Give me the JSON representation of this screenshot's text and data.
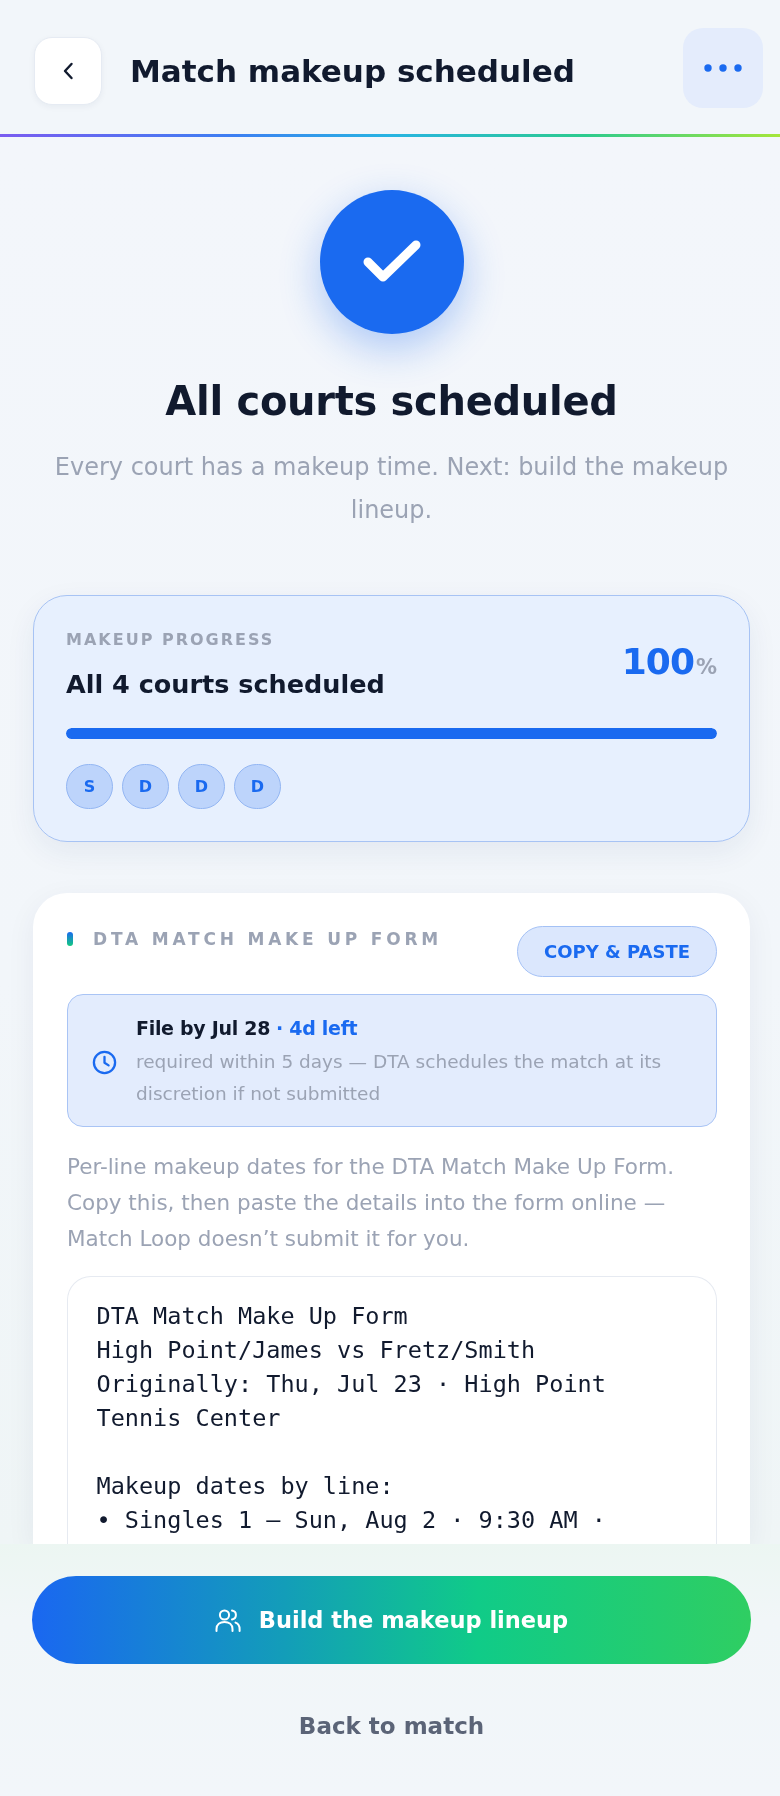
{
  "header": {
    "title": "Match makeup scheduled"
  },
  "hero": {
    "title": "All courts scheduled",
    "subtitle": "Every court has a makeup time. Next: build the makeup lineup."
  },
  "progress": {
    "label": "MAKEUP PROGRESS",
    "title": "All 4 courts scheduled",
    "percent": "100",
    "percent_sign": "%",
    "level": 1,
    "courts": [
      {
        "label": "S",
        "scheduled": true
      },
      {
        "label": "D",
        "scheduled": true
      },
      {
        "label": "D",
        "scheduled": true
      },
      {
        "label": "D",
        "scheduled": true
      }
    ]
  },
  "form": {
    "title": "DTA MATCH MAKE UP FORM",
    "copy_button": "COPY & PASTE",
    "deadline": {
      "title": "File by Jul 28",
      "remaining": "· 4d left",
      "note": "required within 5 days — DTA schedules the match at its discretion if not submitted"
    },
    "description": "Per-line makeup dates for the DTA Match Make Up Form. Copy this, then paste the details into the form online — Match Loop doesn’t submit it for you.",
    "text": "DTA Match Make Up Form\nHigh Point/James vs Fretz/Smith\nOriginally: Thu, Jul 23 · High Point Tennis Center\n\nMakeup dates by line:\n• Singles 1 — Sun, Aug 2 · 9:30 AM ·"
  },
  "actions": {
    "primary": "Build the makeup lineup",
    "secondary": "Back to match"
  }
}
